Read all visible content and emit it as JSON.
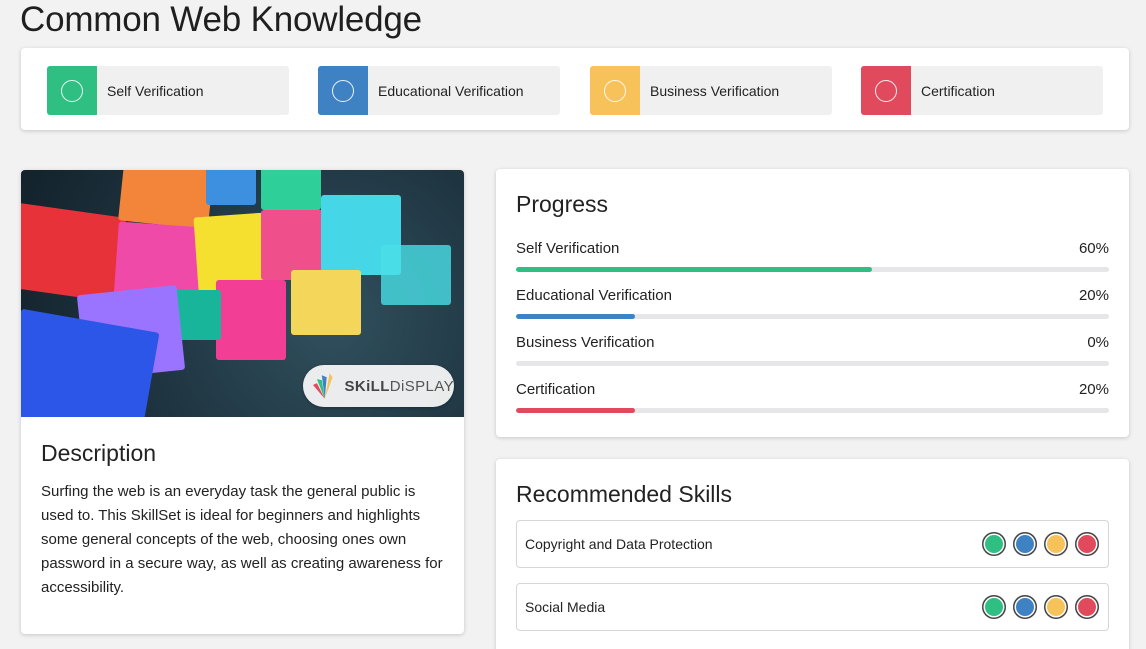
{
  "page": {
    "title": "Common Web Knowledge"
  },
  "colors": {
    "green": "#2fbf83",
    "blue": "#3e82c4",
    "yellow": "#f7c25a",
    "red": "#e14a5c"
  },
  "verifications": [
    {
      "label": "Self Verification",
      "color": "#2fbf83"
    },
    {
      "label": "Educational Verification",
      "color": "#3e82c4"
    },
    {
      "label": "Business Verification",
      "color": "#f7c25a"
    },
    {
      "label": "Certification",
      "color": "#e14a5c"
    }
  ],
  "logo": {
    "brand_a": "SKiLL",
    "brand_b": "DiSPLAY"
  },
  "description": {
    "title": "Description",
    "text": "Surfing the web is an everyday task the general public is used to. This SkillSet is ideal for beginners and highlights some general concepts of the web, choosing ones own password in a secure way, as well as creating awareness for accessibility."
  },
  "progress": {
    "title": "Progress",
    "rows": [
      {
        "label": "Self Verification",
        "value_text": "60%",
        "fraction": 0.6,
        "color": "#2fbf83"
      },
      {
        "label": "Educational Verification",
        "value_text": "20%",
        "fraction": 0.2,
        "color": "#3e82c4"
      },
      {
        "label": "Business Verification",
        "value_text": "0%",
        "fraction": 0.0,
        "color": "#f7c25a"
      },
      {
        "label": "Certification",
        "value_text": "20%",
        "fraction": 0.2,
        "color": "#e14a5c"
      }
    ]
  },
  "skills": {
    "title": "Recommended Skills",
    "items": [
      {
        "name": "Copyright and Data Protection"
      },
      {
        "name": "Social Media"
      }
    ]
  }
}
